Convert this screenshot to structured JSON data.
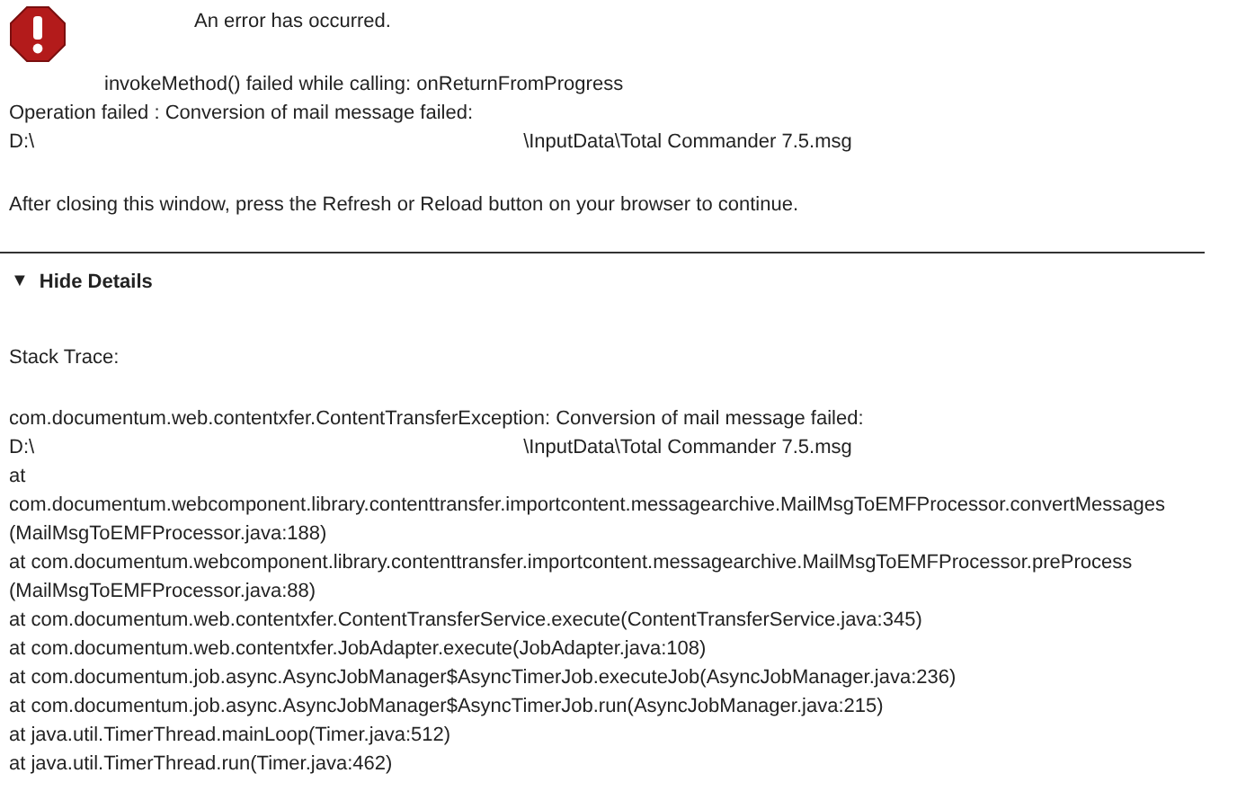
{
  "title": "An error has occurred.",
  "message": "invokeMethod() failed while calling: onReturnFromProgress",
  "operation": "Operation failed : Conversion of mail message failed:",
  "path": {
    "drive": "D:\\",
    "rest": "\\InputData\\Total Commander 7.5.msg"
  },
  "instruction": "After closing this window, press the Refresh or Reload button on your browser to continue.",
  "details_toggle": {
    "arrow": "▼",
    "label": "Hide Details",
    "expanded": true
  },
  "stack_trace": {
    "heading": "Stack Trace:",
    "lines": [
      {
        "kind": "text",
        "text": "com.documentum.web.contentxfer.ContentTransferException: Conversion of mail message failed:"
      },
      {
        "kind": "path",
        "drive": "D:\\",
        "rest": "\\InputData\\Total Commander 7.5.msg"
      },
      {
        "kind": "text",
        "text": "at"
      },
      {
        "kind": "text",
        "text": "com.documentum.webcomponent.library.contenttransfer.importcontent.messagearchive.MailMsgToEMFProcessor.convertMessages"
      },
      {
        "kind": "text",
        "text": "(MailMsgToEMFProcessor.java:188)"
      },
      {
        "kind": "text",
        "text": "at com.documentum.webcomponent.library.contenttransfer.importcontent.messagearchive.MailMsgToEMFProcessor.preProcess"
      },
      {
        "kind": "text",
        "text": "(MailMsgToEMFProcessor.java:88)"
      },
      {
        "kind": "text",
        "text": "at com.documentum.web.contentxfer.ContentTransferService.execute(ContentTransferService.java:345)"
      },
      {
        "kind": "text",
        "text": "at com.documentum.web.contentxfer.JobAdapter.execute(JobAdapter.java:108)"
      },
      {
        "kind": "text",
        "text": "at com.documentum.job.async.AsyncJobManager$AsyncTimerJob.executeJob(AsyncJobManager.java:236)"
      },
      {
        "kind": "text",
        "text": "at com.documentum.job.async.AsyncJobManager$AsyncTimerJob.run(AsyncJobManager.java:215)"
      },
      {
        "kind": "text",
        "text": "at java.util.TimerThread.mainLoop(Timer.java:512)"
      },
      {
        "kind": "text",
        "text": "at java.util.TimerThread.run(Timer.java:462)"
      }
    ]
  }
}
